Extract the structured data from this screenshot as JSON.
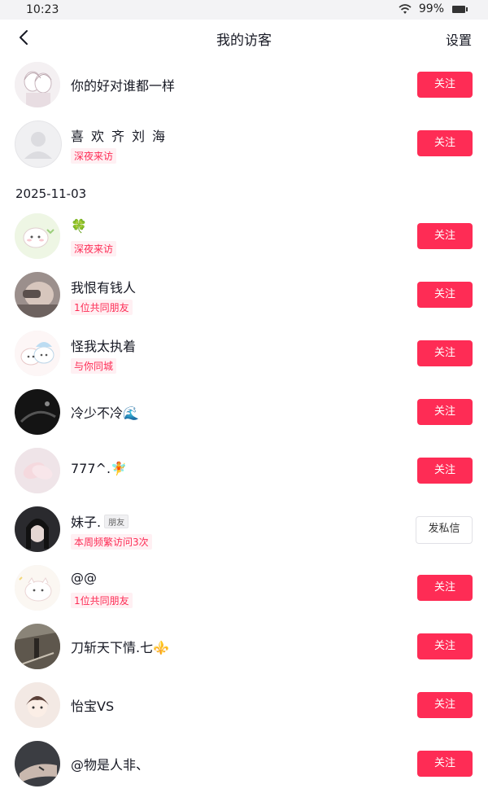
{
  "status_bar": {
    "time": "10:23",
    "battery": "99%"
  },
  "nav": {
    "title": "我的访客",
    "settings": "设置"
  },
  "date_header": "2025-11-03",
  "visitors": [
    {
      "name": "你的好对谁都一样",
      "tag": "",
      "badge": "",
      "button": "关注",
      "avatar": "couple-sketch"
    },
    {
      "name": "喜欢齐刘海",
      "tag": "深夜来访",
      "badge": "",
      "button": "关注",
      "avatar": "default-avatar"
    },
    {
      "name": "🍀",
      "tag": "深夜来访",
      "badge": "",
      "button": "关注",
      "avatar": "cartoon-sheep"
    },
    {
      "name": "我恨有钱人",
      "tag": "1位共同朋友",
      "badge": "",
      "button": "关注",
      "avatar": "photo"
    },
    {
      "name": "怪我太执着",
      "tag": "与你同城",
      "badge": "",
      "button": "关注",
      "avatar": "cartoon-pair"
    },
    {
      "name": "冷少不冷🌊",
      "tag": "",
      "badge": "",
      "button": "关注",
      "avatar": "dark-photo"
    },
    {
      "name": "777^.🧚",
      "tag": "",
      "badge": "",
      "button": "关注",
      "avatar": "hands-photo"
    },
    {
      "name": "妹子.",
      "tag": "本周频繁访问3次",
      "badge": "朋友",
      "button": "发私信",
      "avatar": "girl-photo"
    },
    {
      "name": "@@",
      "tag": "1位共同朋友",
      "badge": "",
      "button": "关注",
      "avatar": "cartoon-cat"
    },
    {
      "name": "刀斩天下情.七⚜️",
      "tag": "",
      "badge": "",
      "button": "关注",
      "avatar": "street-photo"
    },
    {
      "name": "怡宝VS",
      "tag": "",
      "badge": "",
      "button": "关注",
      "avatar": "anime-girl"
    },
    {
      "name": "@物是人非、",
      "tag": "",
      "badge": "",
      "button": "关注",
      "avatar": "hand-photo"
    }
  ],
  "colors": {
    "accent": "#fe2c55",
    "tag_bg": "#fff0f3"
  }
}
